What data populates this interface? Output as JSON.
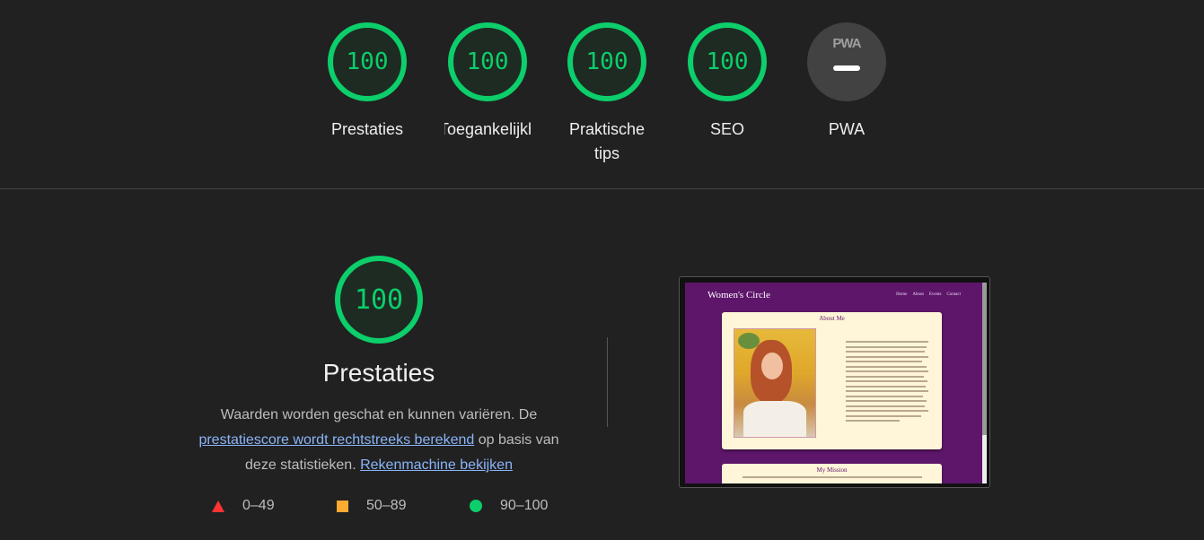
{
  "top_scores": [
    {
      "score": "100",
      "label": "Prestaties"
    },
    {
      "score": "100",
      "label": "Toegankelijkheid"
    },
    {
      "score": "100",
      "label": "Praktische tips"
    },
    {
      "score": "100",
      "label": "SEO"
    },
    {
      "badge": "PWA",
      "label": "PWA"
    }
  ],
  "main": {
    "score": "100",
    "title": "Prestaties",
    "desc_text_1": "Waarden worden geschat en kunnen variëren. De ",
    "desc_link_1": "prestatiescore wordt rechtstreeks berekend",
    "desc_text_2": " op basis van deze statistieken. ",
    "desc_link_2": "Rekenmachine bekijken"
  },
  "legend": [
    {
      "range": "0–49",
      "shape": "triangle",
      "color": "#ff3333"
    },
    {
      "range": "50–89",
      "shape": "square",
      "color": "#ffaa33"
    },
    {
      "range": "90–100",
      "shape": "circle",
      "color": "#0cce6b"
    }
  ],
  "screenshot": {
    "brand": "Women's Circle",
    "nav": [
      "Home",
      "About",
      "Events",
      "Contact"
    ],
    "card1_title": "About Me",
    "card2_title": "My Mission"
  },
  "colors": {
    "pass": "#0cce6b",
    "background": "#212121",
    "link": "#8ab4f8",
    "site_purple": "#5e166b"
  }
}
